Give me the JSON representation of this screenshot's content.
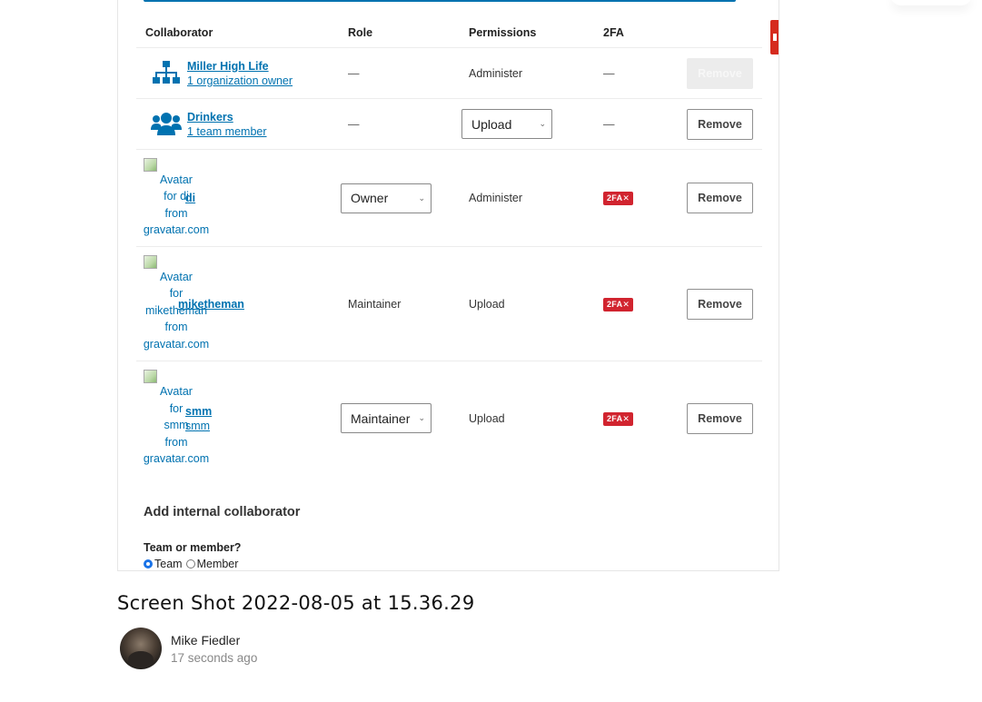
{
  "table": {
    "headers": {
      "collaborator": "Collaborator",
      "role": "Role",
      "permissions": "Permissions",
      "twofa": "2FA"
    },
    "rows": [
      {
        "type": "org",
        "icon": "sitemap-icon",
        "name": "Miller High Life",
        "sub": "1 organization owner",
        "role": "—",
        "permissions": "Administer",
        "twofa": "—",
        "action": "Remove",
        "action_disabled": true
      },
      {
        "type": "team",
        "icon": "users-icon",
        "name": "Drinkers",
        "sub": "1 team member",
        "role": "—",
        "permissions_select": "Upload",
        "twofa": "—",
        "action": "Remove"
      },
      {
        "type": "user",
        "avatar_alt": [
          "Avatar",
          "for di",
          "from",
          "gravatar.com"
        ],
        "name": "di",
        "role_select": "Owner",
        "permissions": "Administer",
        "twofa_badge": "2FA✕",
        "action": "Remove"
      },
      {
        "type": "user",
        "avatar_alt": [
          "Avatar",
          "for",
          "miketheman",
          "from",
          "gravatar.com"
        ],
        "name": "miketheman",
        "role": "Maintainer",
        "permissions": "Upload",
        "twofa_badge": "2FA✕",
        "action": "Remove"
      },
      {
        "type": "user",
        "avatar_alt": [
          "Avatar",
          "for",
          "smm",
          "from",
          "gravatar.com"
        ],
        "name": "smm",
        "sub": "smm",
        "role_select": "Maintainer",
        "permissions": "Upload",
        "twofa_badge": "2FA✕",
        "action": "Remove"
      }
    ]
  },
  "add": {
    "title": "Add internal collaborator",
    "question": "Team or member?",
    "options": [
      "Team",
      "Member"
    ],
    "selected": "Team"
  },
  "caption": "Screen Shot 2022-08-05 at 15.36.29",
  "author": {
    "name": "Mike Fiedler",
    "time": "17 seconds ago"
  },
  "colors": {
    "link": "#0072b0",
    "danger": "#d1242f",
    "radio": "#1a73e8"
  }
}
